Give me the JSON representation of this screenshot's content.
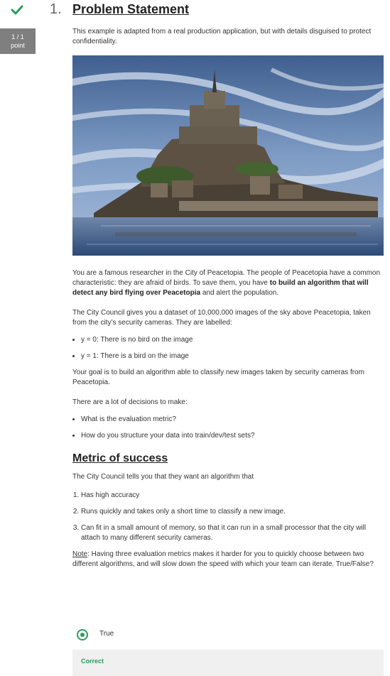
{
  "question": {
    "number": "1.",
    "score": {
      "value": "1 / 1",
      "unit": "point"
    },
    "status_icon": "checkmark-icon",
    "title": "Problem Statement",
    "intro": "This example is adapted from a real production application, but with details disguised to protect confidentiality.",
    "image_subject": "island-castle-photo",
    "para1_start": "You are a famous researcher in the City of Peacetopia. The people of Peacetopia have a common characteristic: they are afraid of birds. To save them, you have ",
    "para1_bold": "to build an algorithm that will detect any bird flying over Peacetopia",
    "para1_end": " and alert the population.",
    "para2": "The City Council gives you a dataset of 10,000,000 images of the sky above Peacetopia, taken from the city’s security cameras. They are labelled:",
    "labels": [
      "y = 0: There is no bird on the image",
      "y = 1: There is a bird on the image"
    ],
    "para3": "Your goal is to build an algorithm able to classify new images taken by security cameras from Peacetopia.",
    "para4": "There are a lot of decisions to make:",
    "decisions": [
      "What is the evaluation metric?",
      "How do you structure your data into train/dev/test sets?"
    ],
    "metric_title": "Metric of success",
    "metric_intro": "The City Council tells you that they want an algorithm that",
    "requirements": [
      "Has high accuracy",
      "Runs quickly and takes only a short time to classify a new image.",
      "Can fit in a small amount of memory, so that it can run in a small processor that the city will attach to many different security cameras."
    ],
    "note_label": "Note",
    "note_text": ": Having three evaluation metrics makes it harder for you to quickly choose between two different algorithms, and will slow down the speed with which your team can iterate. True/False?",
    "answer": "True",
    "feedback": "Correct"
  },
  "colors": {
    "accent_green": "#2e9a5c",
    "score_badge": "#7f7f7f",
    "feedback_bg": "#f0f0f0"
  }
}
